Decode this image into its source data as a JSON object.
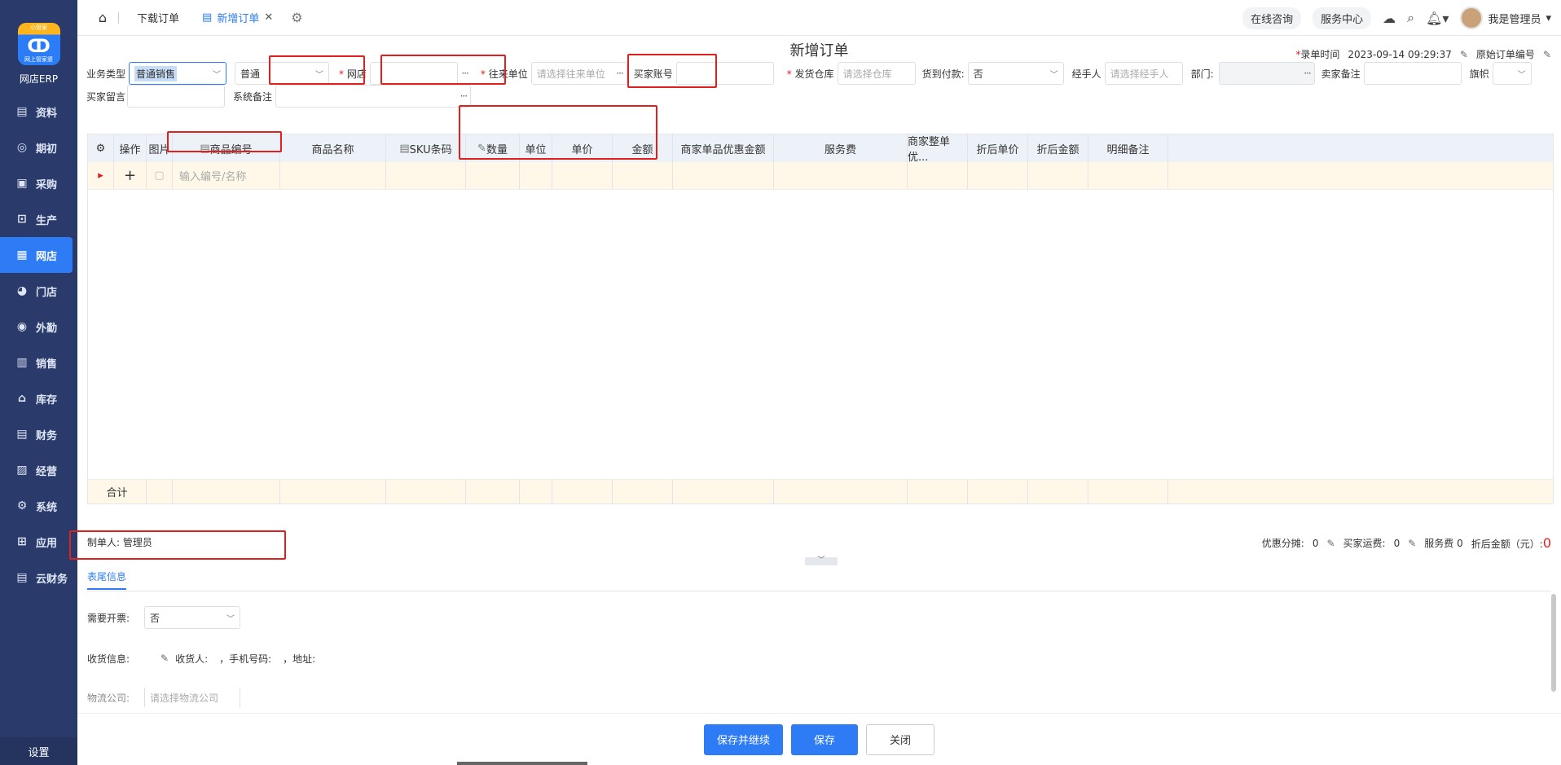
{
  "app": {
    "logo_top": "小管家",
    "logo_sub": "网上管家婆",
    "name": "网店ERP"
  },
  "sidebar": {
    "items": [
      {
        "label": "资料",
        "icon": "document-icon"
      },
      {
        "label": "期初",
        "icon": "target-icon"
      },
      {
        "label": "采购",
        "icon": "cart-icon"
      },
      {
        "label": "生产",
        "icon": "factory-icon"
      },
      {
        "label": "网店",
        "icon": "store-icon",
        "active": true
      },
      {
        "label": "门店",
        "icon": "pie-icon"
      },
      {
        "label": "外勤",
        "icon": "compass-icon"
      },
      {
        "label": "销售",
        "icon": "bar-chart-icon"
      },
      {
        "label": "库存",
        "icon": "warehouse-icon"
      },
      {
        "label": "财务",
        "icon": "wallet-icon"
      },
      {
        "label": "经营",
        "icon": "chart-icon"
      },
      {
        "label": "系统",
        "icon": "gear-icon"
      },
      {
        "label": "应用",
        "icon": "plus-square-icon"
      },
      {
        "label": "云财务",
        "icon": "cloud-wallet-icon"
      }
    ],
    "settings": "设置"
  },
  "topbar": {
    "tabs": [
      {
        "label": "下载订单"
      },
      {
        "label": "新增订单",
        "active": true
      }
    ],
    "consult": "在线咨询",
    "service": "服务中心",
    "user": "我是管理员"
  },
  "page": {
    "title": "新增订单",
    "entry_time_label": "录单时间",
    "entry_time": "2023-09-14 09:29:37",
    "orig_order_label": "原始订单编号"
  },
  "form": {
    "biz_type_label": "业务类型",
    "biz_type_value": "普通销售",
    "biz_sub_value": "普通",
    "shop_label": "网店",
    "partner_label": "往来单位",
    "partner_placeholder": "请选择往来单位",
    "buyer_account_label": "买家账号",
    "warehouse_label": "发货仓库",
    "warehouse_placeholder": "请选择仓库",
    "cod_label": "货到付款:",
    "cod_value": "否",
    "handler_label": "经手人",
    "handler_placeholder": "请选择经手人",
    "dept_label": "部门:",
    "seller_note_label": "卖家备注",
    "flag_label": "旗帜",
    "buyer_msg_label": "买家留言",
    "sys_note_label": "系统备注"
  },
  "grid": {
    "columns": [
      "操作",
      "图片",
      "商品编号",
      "商品名称",
      "SKU条码",
      "数量",
      "单位",
      "单价",
      "金额",
      "商家单品优惠金额",
      "服务费",
      "商家整单优...",
      "折后单价",
      "折后金额",
      "明细备注"
    ],
    "row_input_placeholder": "输入编号/名称",
    "total_label": "合计"
  },
  "bottom": {
    "creator_label": "制单人:",
    "creator": "管理员",
    "discount_label": "优惠分摊:",
    "discount_value": "0",
    "freight_label": "买家运费:",
    "freight_value": "0",
    "service_fee_label": "服务费",
    "service_fee_value": "0",
    "net_amount_label": "折后金额（元）:",
    "net_amount_value": "0"
  },
  "tail": {
    "tab": "表尾信息",
    "invoice_label": "需要开票:",
    "invoice_value": "否",
    "receiver_label": "收货信息:",
    "receiver_name_label": "收货人:",
    "receiver_phone_label": "，手机号码:",
    "receiver_addr_label": "，地址:",
    "logistics_label": "物流公司:",
    "logistics_placeholder": "请选择物流公司"
  },
  "buttons": {
    "save_continue": "保存并继续",
    "save": "保存",
    "close": "关闭"
  }
}
